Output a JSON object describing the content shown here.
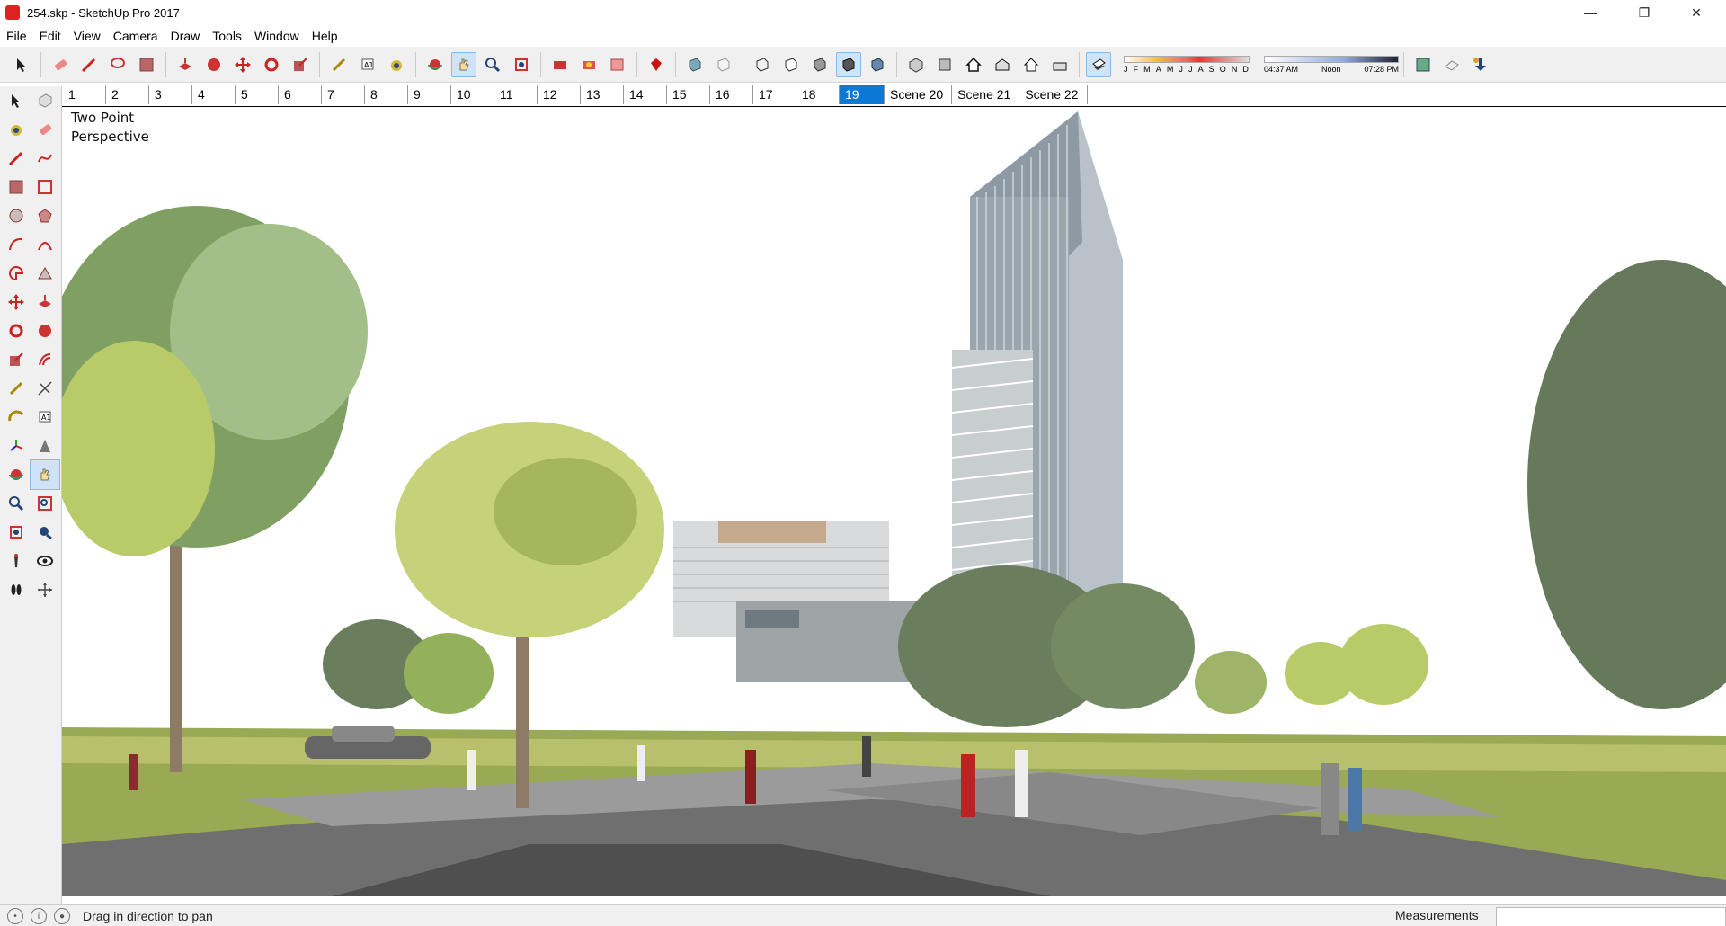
{
  "window": {
    "title": "254.skp - SketchUp Pro 2017"
  },
  "menu": [
    "File",
    "Edit",
    "View",
    "Camera",
    "Draw",
    "Tools",
    "Window",
    "Help"
  ],
  "shadow": {
    "months": [
      "J",
      "F",
      "M",
      "A",
      "M",
      "J",
      "J",
      "A",
      "S",
      "O",
      "N",
      "D"
    ],
    "time_start": "04:37 AM",
    "time_mid": "Noon",
    "time_end": "07:28 PM"
  },
  "scenes": {
    "tabs": [
      "1",
      "2",
      "3",
      "4",
      "5",
      "6",
      "7",
      "8",
      "9",
      "10",
      "11",
      "12",
      "13",
      "14",
      "15",
      "16",
      "17",
      "18",
      "19",
      "Scene 20",
      "Scene 21",
      "Scene 22"
    ],
    "active": "19"
  },
  "viewport": {
    "camera_label_line1": "Two Point",
    "camera_label_line2": "Perspective"
  },
  "status": {
    "hint": "Drag in direction to pan",
    "measurements_label": "Measurements",
    "measurements_value": ""
  },
  "colors": {
    "accent": "#0a78d4",
    "sky": "#ffffff",
    "grass": "#8fa14a"
  },
  "icons": {
    "toolbar": [
      "select-icon",
      "eraser-icon",
      "pencil-icon",
      "lasso-icon",
      "rectangle-icon",
      "push-pull-icon",
      "follow-me-icon",
      "move-icon",
      "rotate-icon",
      "scale-icon",
      "tape-measure-icon",
      "text-icon",
      "paint-bucket-icon",
      "orbit-icon",
      "pan-icon",
      "zoom-icon",
      "zoom-extents-icon",
      "3d-warehouse-icon",
      "extension-warehouse-icon",
      "layout-icon",
      "ruby-icon",
      "xray-icon",
      "back-edges-icon",
      "wireframe-icon",
      "hidden-line-icon",
      "shaded-icon",
      "shaded-textures-icon",
      "monochrome-icon",
      "iso-view-icon",
      "top-view-icon",
      "front-view-icon",
      "right-view-icon",
      "back-view-icon",
      "left-view-icon",
      "shadows-toggle-icon",
      "geo-location-icon",
      "sandbox-icon",
      "add-location-icon"
    ],
    "left": [
      "select-icon",
      "component-icon",
      "paint-bucket-icon",
      "eraser-icon",
      "line-icon",
      "freehand-icon",
      "rectangle-icon",
      "rotated-rectangle-icon",
      "circle-icon",
      "polygon-icon",
      "arc-icon",
      "two-point-arc-icon",
      "pie-icon",
      "three-point-arc-icon",
      "move-icon",
      "push-pull-icon",
      "rotate-icon",
      "follow-me-icon",
      "scale-icon",
      "offset-icon",
      "tape-measure-icon",
      "dimension-icon",
      "protractor-icon",
      "text-icon",
      "axes-icon",
      "3d-text-icon",
      "orbit-icon",
      "pan-icon",
      "zoom-icon",
      "zoom-window-icon",
      "zoom-extents-icon",
      "previous-view-icon",
      "position-camera-icon",
      "look-around-icon",
      "walk-icon",
      "section-plane-icon"
    ]
  }
}
